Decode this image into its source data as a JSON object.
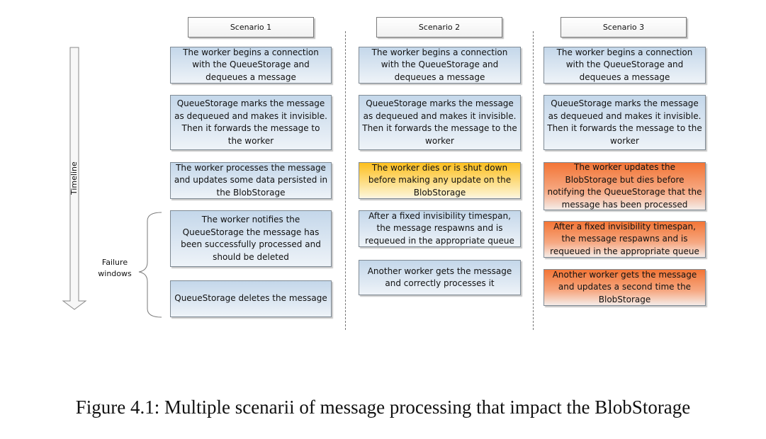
{
  "timeline_label": "Timeline",
  "failure_windows_label": "Failure windows",
  "scenarios": [
    {
      "title": "Scenario 1",
      "steps": [
        {
          "text": "The worker begins a connection with the QueueStorage and dequeues a message",
          "status": "normal"
        },
        {
          "text": "QueueStorage marks the message as dequeued and makes it invisible. Then it forwards the message to the worker",
          "status": "normal"
        },
        {
          "text": "The worker processes the message and updates some data persisted in the BlobStorage",
          "status": "normal"
        },
        {
          "text": "The worker notifies the QueueStorage the message has been successfully processed and should be deleted",
          "status": "normal"
        },
        {
          "text": "QueueStorage deletes the message",
          "status": "normal"
        }
      ]
    },
    {
      "title": "Scenario 2",
      "steps": [
        {
          "text": "The worker begins a connection with the QueueStorage and dequeues a message",
          "status": "normal"
        },
        {
          "text": "QueueStorage marks the message as dequeued and makes it invisible. Then it forwards the message to the worker",
          "status": "normal"
        },
        {
          "text": "The worker dies or is shut down before making any update on the BlobStorage",
          "status": "warning"
        },
        {
          "text": "After a fixed invisibility timespan, the message respawns and is requeued in the appropriate queue",
          "status": "normal"
        },
        {
          "text": "Another worker gets the message and correctly processes it",
          "status": "normal"
        }
      ]
    },
    {
      "title": "Scenario 3",
      "steps": [
        {
          "text": "The worker begins a connection with the QueueStorage and dequeues a message",
          "status": "normal"
        },
        {
          "text": "QueueStorage marks the message as dequeued and makes it invisible. Then it forwards the message to the worker",
          "status": "normal"
        },
        {
          "text": "The worker updates the BlobStorage but dies before notifying the QueueStorage that the message has been processed",
          "status": "error"
        },
        {
          "text": "After a fixed invisibility timespan, the message respawns and is requeued in the appropriate queue",
          "status": "error"
        },
        {
          "text": "Another worker gets the message and updates a second time the BlobStorage",
          "status": "error"
        }
      ]
    }
  ],
  "colors": {
    "normal": "#c4d7ea",
    "warning": "#fdbf1e",
    "error": "#f37536"
  },
  "caption": "Figure 4.1: Multiple scenarii of message processing that impact the BlobStorage"
}
